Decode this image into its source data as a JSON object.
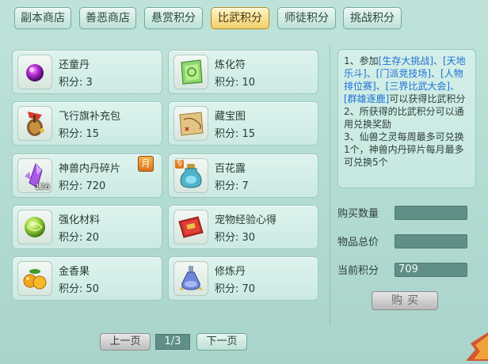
{
  "tabs": [
    {
      "label": "副本商店",
      "active": false
    },
    {
      "label": "善恶商店",
      "active": false
    },
    {
      "label": "悬赏积分",
      "active": false
    },
    {
      "label": "比武积分",
      "active": true
    },
    {
      "label": "师徒积分",
      "active": false
    },
    {
      "label": "挑战积分",
      "active": false
    }
  ],
  "points_prefix": "积分: ",
  "items": [
    {
      "name": "还童丹",
      "points": "3",
      "icon": "purple-orb-icon"
    },
    {
      "name": "炼化符",
      "points": "10",
      "icon": "talisman-icon"
    },
    {
      "name": "飞行旗补充包",
      "points": "15",
      "icon": "flag-pack-icon"
    },
    {
      "name": "藏宝图",
      "points": "15",
      "icon": "treasure-map-icon"
    },
    {
      "name": "神兽内丹碎片",
      "points": "720",
      "icon": "crystal-shard-icon",
      "count": "126",
      "badge": "月"
    },
    {
      "name": "百花露",
      "points": "7",
      "icon": "potion-bottle-icon",
      "corner": "专"
    },
    {
      "name": "强化材料",
      "points": "20",
      "icon": "green-orb-icon"
    },
    {
      "name": "宠物经验心得",
      "points": "30",
      "icon": "red-book-icon"
    },
    {
      "name": "金香果",
      "points": "50",
      "icon": "golden-fruit-icon"
    },
    {
      "name": "修炼丹",
      "points": "70",
      "icon": "elixir-flask-icon"
    }
  ],
  "description": {
    "p1_a": "1、参加",
    "p1_link1": "[生存大挑战]、[天地乐斗]、[门派竞技场]、[人物排位赛]、[三界比武大会]、[群雄逐鹿]",
    "p1_b": "可以获得比武积分",
    "p2": "2、所获得的比武积分可以通用兑换奖励",
    "p3": "3、仙兽之灵每周最多可兑换1个，神兽内丹碎片每月最多可兑换5个"
  },
  "form": {
    "quantity_label": "购买数量",
    "quantity_value": "",
    "total_label": "物品总价",
    "total_value": "",
    "current_label": "当前积分",
    "current_value": "709",
    "buy_label": "购买"
  },
  "pager": {
    "prev_label": "上一页",
    "indicator": "1/3",
    "next_label": "下一页"
  },
  "colors": {
    "active_tab": "#f0cf68",
    "panel_bg": "#b2dbd2",
    "link_blue": "#1f6fd6",
    "field_bg": "#5f8f86"
  }
}
